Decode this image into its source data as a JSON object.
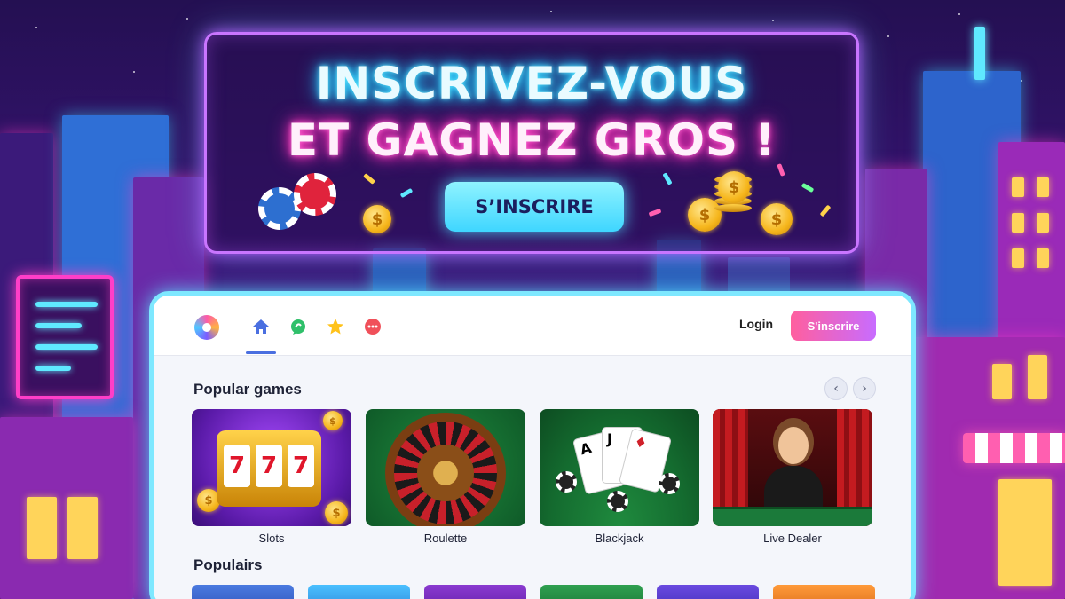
{
  "hero": {
    "line1": "INSCRIVEZ-VOUS",
    "line2": "ET GAGNEZ GROS !",
    "cta_label": "S’INSCRIRE"
  },
  "header": {
    "nav_icons": [
      "home-icon",
      "chat-icon",
      "star-icon",
      "more-icon"
    ],
    "active_nav": "home-icon",
    "login_label": "Login",
    "signup_label": "S'inscrire"
  },
  "popular_games": {
    "title": "Popular games",
    "prev_icon": "chevron-left-icon",
    "next_icon": "chevron-right-icon",
    "games": [
      {
        "label": "Slots"
      },
      {
        "label": "Roulette"
      },
      {
        "label": "Blackjack"
      },
      {
        "label": "Live Dealer"
      }
    ]
  },
  "populairs": {
    "title": "Populairs"
  },
  "colors": {
    "accent_cyan": "#5fe9ff",
    "accent_pink": "#ff2fb8",
    "signup_gradient_start": "#ff5f9e",
    "signup_gradient_end": "#c86cff",
    "active_nav": "#4a6fe0"
  }
}
